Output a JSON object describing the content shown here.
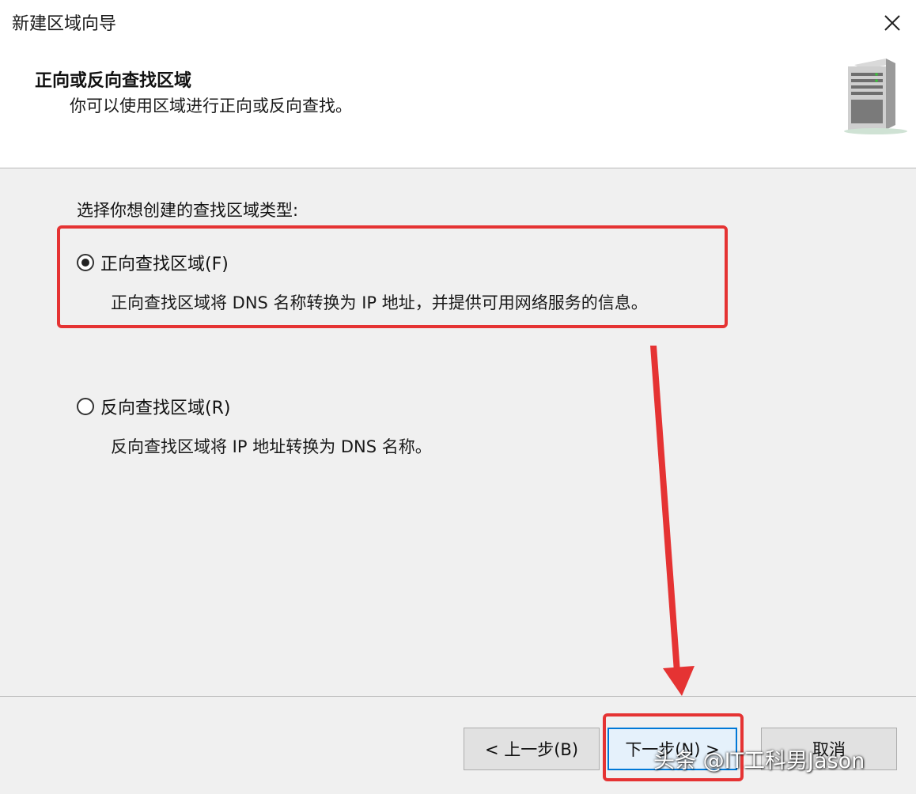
{
  "window": {
    "title": "新建区域向导"
  },
  "header": {
    "title": "正向或反向查找区域",
    "subtitle": "你可以使用区域进行正向或反向查找。",
    "icon": "server-icon"
  },
  "main": {
    "prompt": "选择你想创建的查找区域类型:",
    "options": [
      {
        "label": "正向查找区域(F)",
        "description": "正向查找区域将 DNS 名称转换为 IP 地址，并提供可用网络服务的信息。",
        "selected": true
      },
      {
        "label": "反向查找区域(R)",
        "description": "反向查找区域将 IP 地址转换为 DNS 名称。",
        "selected": false
      }
    ]
  },
  "buttons": {
    "back": "< 上一步(B)",
    "next": "下一步(N) >",
    "cancel": "取消"
  },
  "annotations": {
    "highlight_color": "#e53333",
    "watermark": "头条 @IT工科男Jason"
  }
}
